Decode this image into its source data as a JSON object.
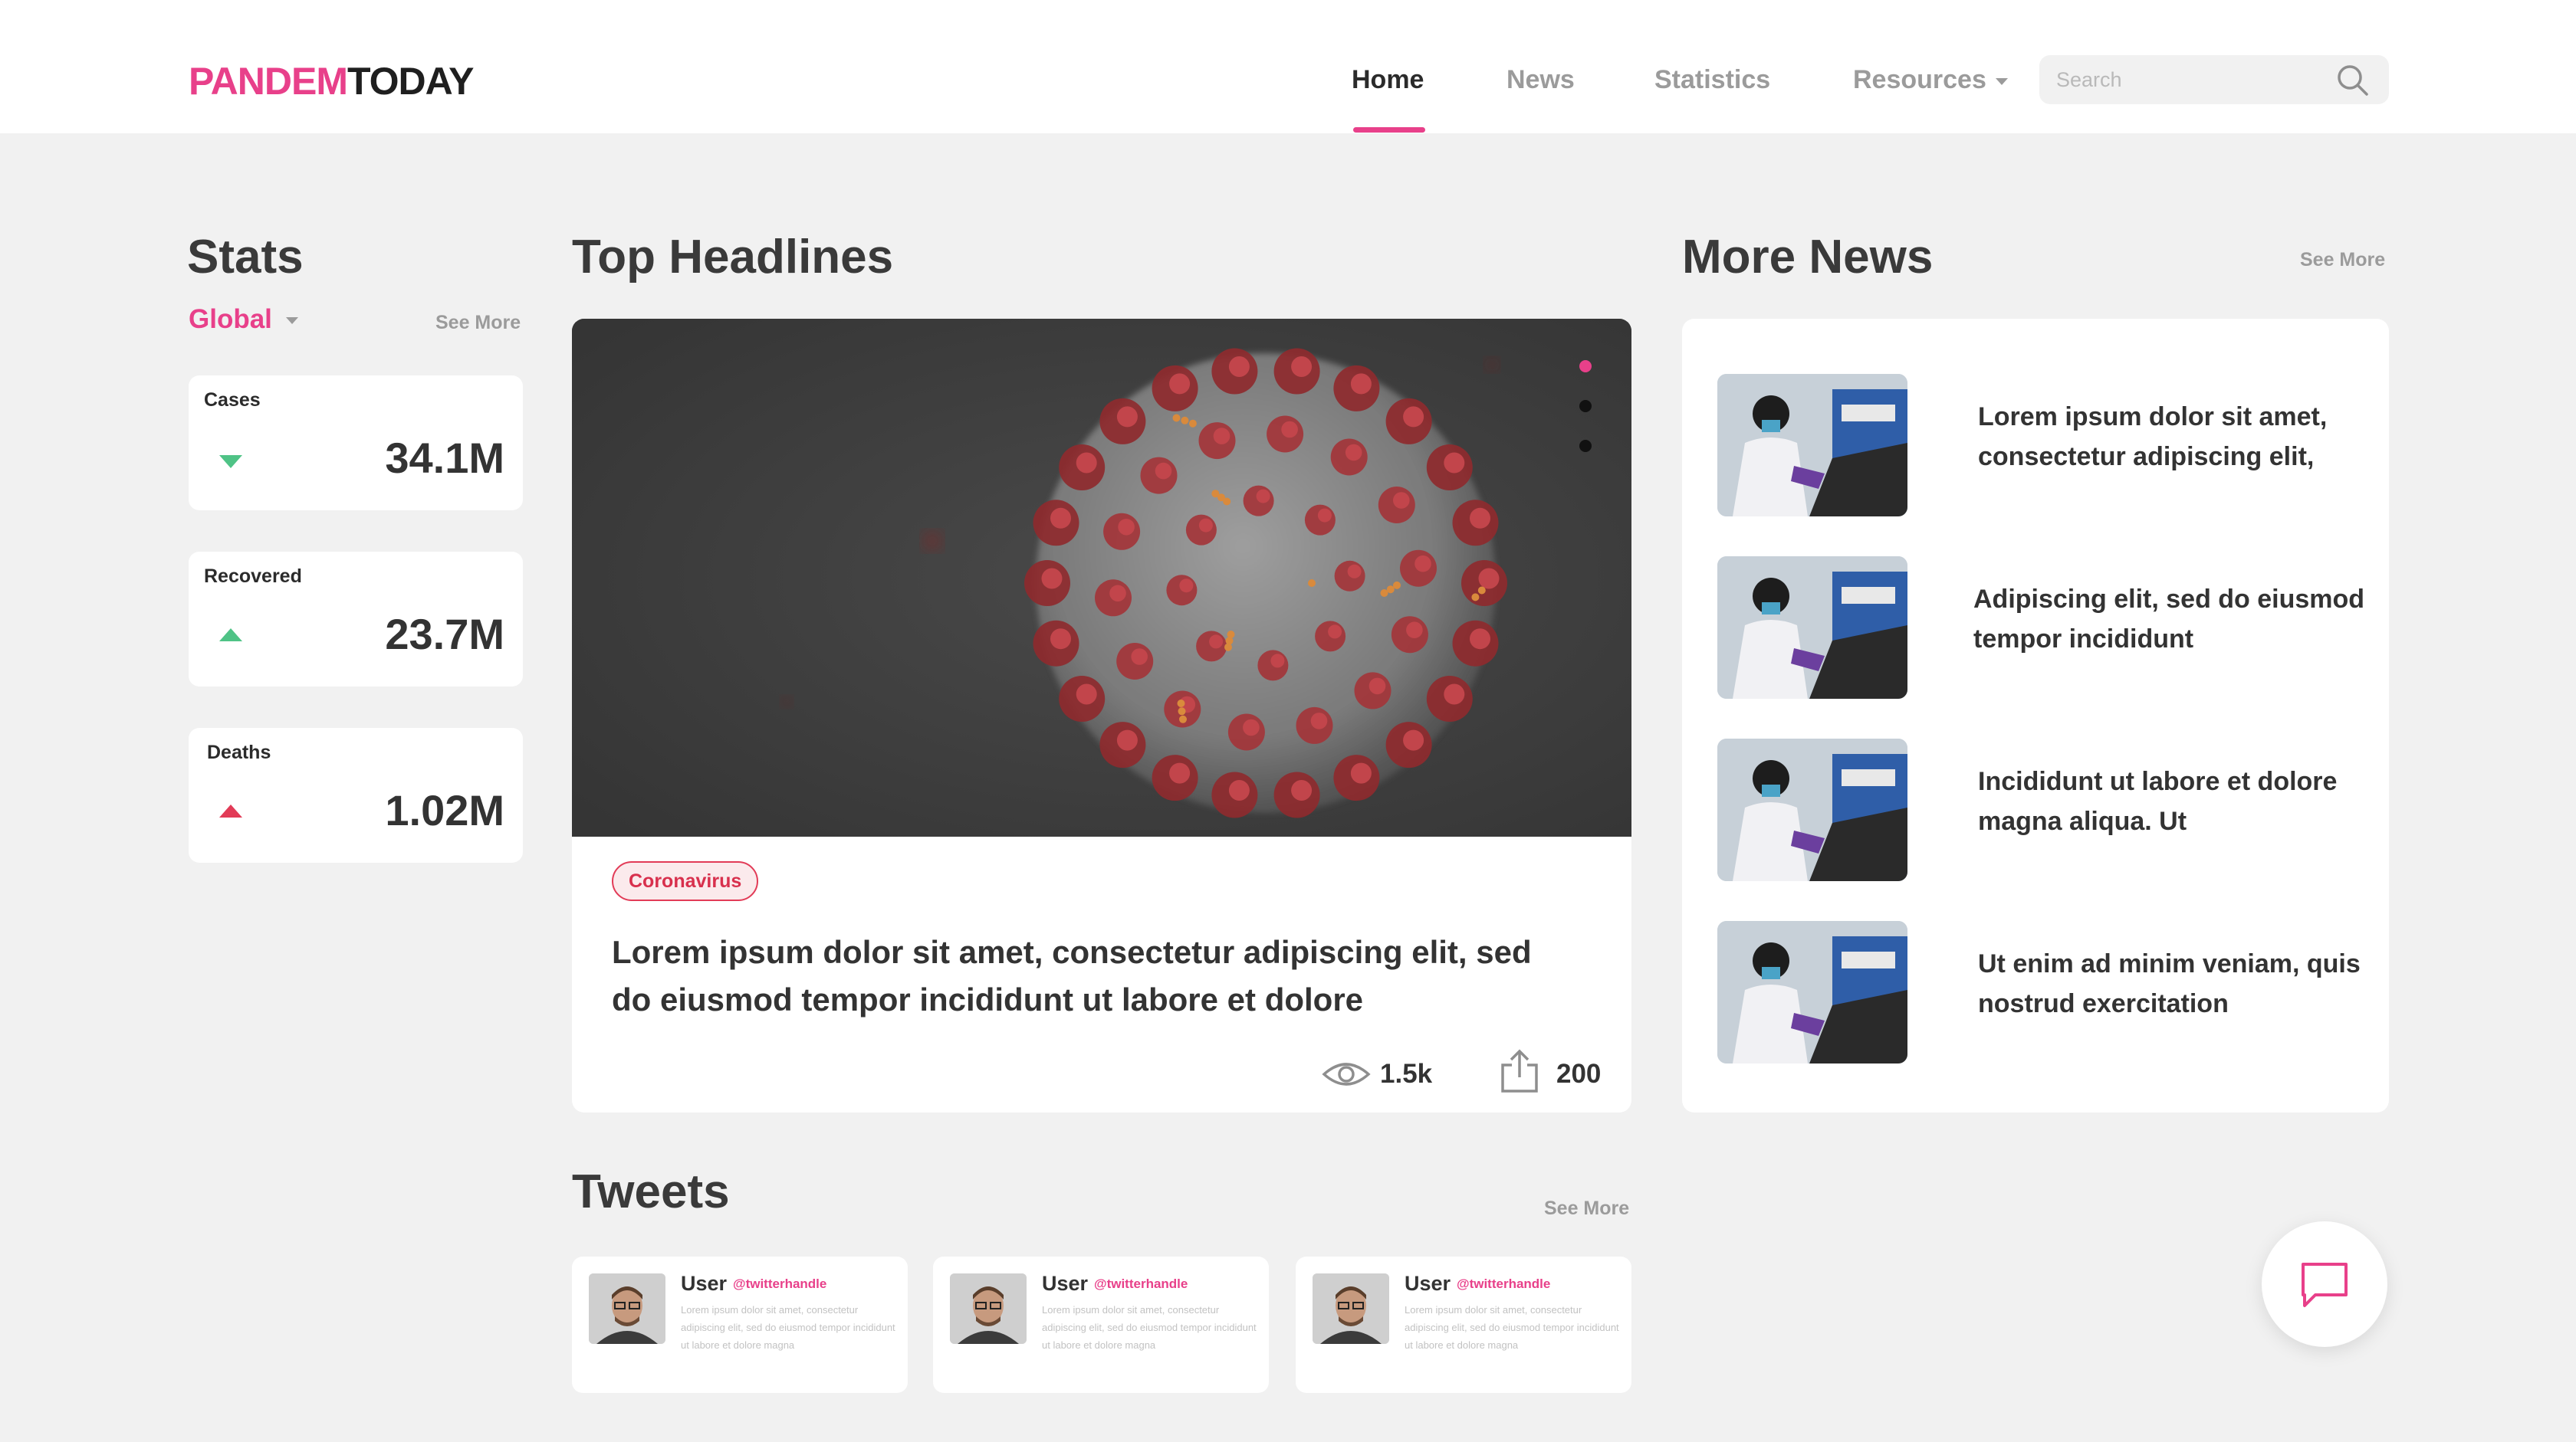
{
  "brand": {
    "part1": "PANDEM",
    "part2": "TODAY"
  },
  "nav": {
    "items": [
      "Home",
      "News",
      "Statistics",
      "Resources"
    ],
    "active": "Home",
    "search_placeholder": "Search"
  },
  "stats": {
    "title": "Stats",
    "region": "Global",
    "see_more": "See More",
    "cards": [
      {
        "label": "Cases",
        "value": "34.1M",
        "trend": "down"
      },
      {
        "label": "Recovered",
        "value": "23.7M",
        "trend": "up"
      },
      {
        "label": "Deaths",
        "value": "1.02M",
        "trend": "up"
      }
    ]
  },
  "headlines": {
    "title": "Top Headlines",
    "tag": "Coronavirus",
    "story_title": "Lorem ipsum dolor sit amet, consectetur adipiscing elit, sed do eiusmod tempor incididunt ut labore et dolore",
    "views": "1.5k",
    "shares": "200",
    "carousel_active_index": 0
  },
  "more_news": {
    "title": "More News",
    "see_more": "See More",
    "items": [
      {
        "text": "Lorem ipsum dolor sit amet, consectetur adipiscing elit,"
      },
      {
        "text": "Adipiscing elit, sed do eiusmod tempor incididunt"
      },
      {
        "text": "Incididunt ut labore et dolore magna aliqua. Ut"
      },
      {
        "text": "Ut enim ad minim veniam, quis nostrud exercitation"
      }
    ]
  },
  "tweets": {
    "title": "Tweets",
    "see_more": "See More",
    "items": [
      {
        "user": "User",
        "handle": "@twitterhandle",
        "body": "Lorem ipsum dolor sit amet, consectetur adipiscing elit, sed do eiusmod tempor incididunt ut labore et dolore magna"
      },
      {
        "user": "User",
        "handle": "@twitterhandle",
        "body": "Lorem ipsum dolor sit amet, consectetur adipiscing elit, sed do eiusmod tempor incididunt ut labore et dolore magna"
      },
      {
        "user": "User",
        "handle": "@twitterhandle",
        "body": "Lorem ipsum dolor sit amet, consectetur adipiscing elit, sed do eiusmod tempor incididunt ut labore et dolore magna"
      }
    ]
  },
  "colors": {
    "accent": "#e8408a",
    "up_trend": "#4fc386",
    "danger": "#e23b57",
    "page_bg": "#f1f1f1"
  },
  "icons": [
    "search-icon",
    "chevron-down-icon",
    "triangle-down-icon",
    "triangle-up-icon",
    "eye-icon",
    "share-icon",
    "chat-icon"
  ]
}
